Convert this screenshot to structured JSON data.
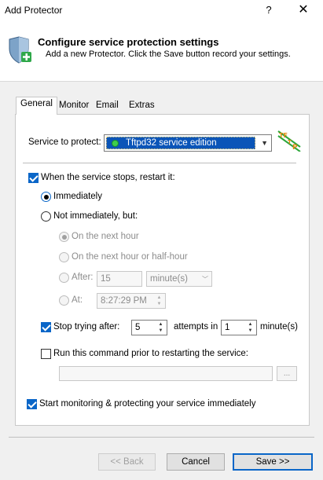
{
  "window": {
    "title": "Add Protector",
    "help_label": "?",
    "close_label": "✕"
  },
  "header": {
    "title": "Configure service protection settings",
    "subtitle": "Add a new Protector. Click the Save button record your settings."
  },
  "tabs": [
    {
      "label": "General",
      "active": true
    },
    {
      "label": "Monitor",
      "active": false
    },
    {
      "label": "Email",
      "active": false
    },
    {
      "label": "Extras",
      "active": false
    }
  ],
  "general": {
    "service_label": "Service to protect:",
    "service_value": "Tftpd32 service edition",
    "restart_checkbox": {
      "label": "When the service stops, restart it:",
      "checked": true
    },
    "immediately": {
      "label": "Immediately",
      "selected": true
    },
    "not_immediately": {
      "label": "Not immediately, but:",
      "selected": false
    },
    "next_hour": {
      "label": "On the next hour",
      "selected": true
    },
    "next_hour_half": {
      "label": "On the next hour or half-hour"
    },
    "after": {
      "label": "After:",
      "value": "15",
      "unit": "minute(s)"
    },
    "at": {
      "label": "At:",
      "value": "8:27:29 PM"
    },
    "stop_trying": {
      "label": "Stop trying after:",
      "checked": true,
      "attempts_value": "5",
      "attempts_label": "attempts in",
      "minutes_value": "1",
      "minutes_label": "minute(s)"
    },
    "run_command": {
      "label": "Run this command prior to restarting the service:",
      "checked": false,
      "value": "",
      "browse_label": "..."
    },
    "start_monitoring": {
      "label": "Start monitoring & protecting your service immediately",
      "checked": true
    }
  },
  "footer": {
    "back_label": "<< Back",
    "cancel_label": "Cancel",
    "save_label": "Save >>"
  }
}
